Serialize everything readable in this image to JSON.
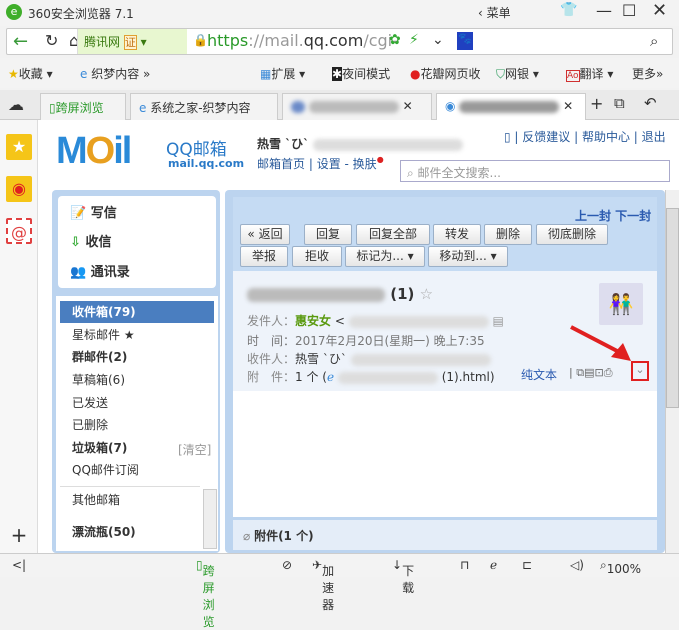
{
  "browser": {
    "title": "360安全浏览器 7.1",
    "menu": "菜单",
    "site_label": "腾讯网",
    "cert": "证",
    "url_https": "https",
    "url_rest": "://mail.",
    "url_domain": "qq.com",
    "url_path": "/cgi-"
  },
  "bookmarks": [
    "收藏",
    "织梦内容",
    "扩展",
    "夜间模式",
    "花瓣网页收",
    "网银",
    "翻译",
    "更多"
  ],
  "tabs": [
    {
      "label": "跨屏浏览"
    },
    {
      "label": "系统之家-织梦内容"
    },
    {
      "label": ""
    },
    {
      "label": ""
    }
  ],
  "mail": {
    "logo": "QQ邮箱",
    "logo_url": "mail.qq.com",
    "user": "热雪 `ひ`",
    "links": [
      "邮箱首页",
      "设置",
      "换肤"
    ],
    "top_links": [
      "反馈建议",
      "帮助中心",
      "退出"
    ],
    "search_placeholder": "邮件全文搜索..."
  },
  "nav": {
    "actions": [
      "写信",
      "收信",
      "通讯录"
    ],
    "folders": [
      {
        "label": "收件箱(79)",
        "bold": true
      },
      {
        "label": "星标邮件 ★"
      },
      {
        "label": "群邮件(2)",
        "bold": true
      },
      {
        "label": "草稿箱(6)"
      },
      {
        "label": "已发送"
      },
      {
        "label": "已删除"
      },
      {
        "label": "垃圾箱(7)",
        "bold": true
      },
      {
        "label": "QQ邮件订阅"
      },
      {
        "label": "其他邮箱"
      },
      {
        "label": "漂流瓶(50)",
        "bold": true
      }
    ],
    "clear": "[清空]"
  },
  "toolbar": {
    "prev_next": "上一封 下一封",
    "row1": [
      "« 返回",
      "回复",
      "回复全部",
      "转发",
      "删除",
      "彻底删除"
    ],
    "row2": [
      "举报",
      "拒收",
      "标记为... ▾",
      "移动到... ▾"
    ]
  },
  "email": {
    "subject_suffix": "(1)",
    "sender_label": "发件人：",
    "sender": "惠安女",
    "time_label": "时　间：",
    "time": "2017年2月20日(星期一) 晚上7:35",
    "to_label": "收件人：",
    "to": "热雪 `ひ`",
    "att_label": "附　件：",
    "att": "1 个 (",
    "att_file": "(1).html)",
    "plain": "纯文本"
  },
  "attachments_bar": "附件(1 个)",
  "statusbar": {
    "cross": "跨屏浏览",
    "accel": "加速器",
    "download": "下载",
    "zoom": "100%"
  }
}
